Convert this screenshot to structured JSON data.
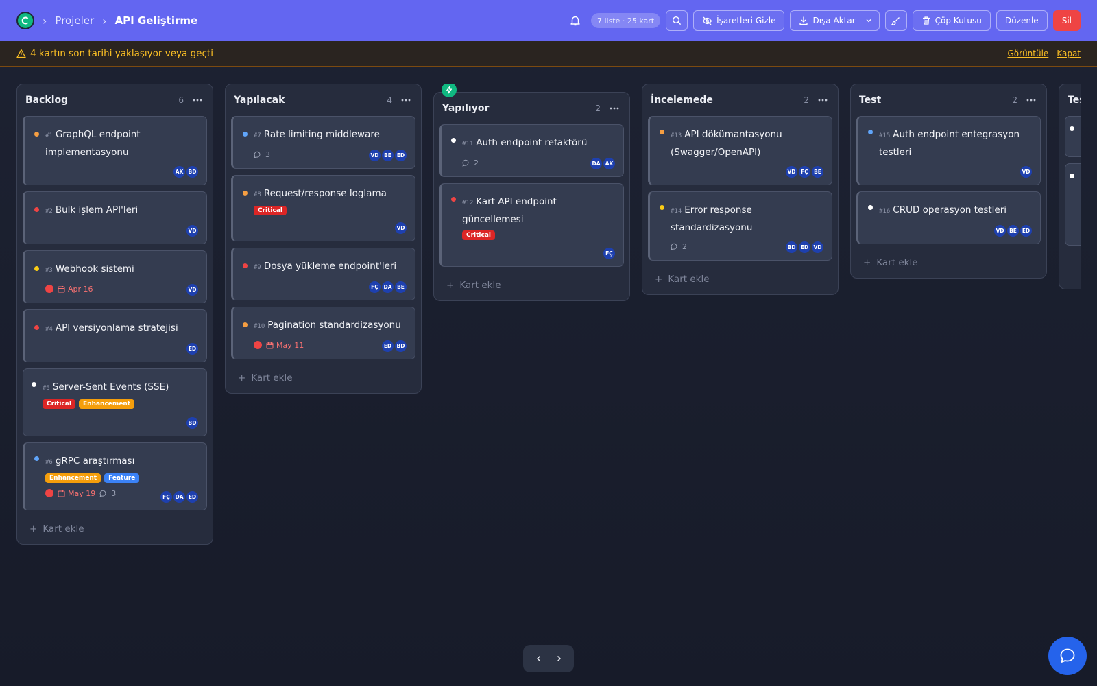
{
  "breadcrumb": {
    "parent": "Projeler",
    "current": "API Geliştirme"
  },
  "toolbar": {
    "stats": "7 liste · 25 kart",
    "hide_marks": "İşaretleri Gizle",
    "export": "Dışa Aktar",
    "trash": "Çöp Kutusu",
    "edit": "Düzenle",
    "delete": "Sil"
  },
  "alert": {
    "message": "4 kartın son tarihi yaklaşıyor veya geçti",
    "view": "Görüntüle",
    "close": "Kapat"
  },
  "add_card_label": "Kart ekle",
  "colors": {
    "topbar": "#6366f1",
    "critical": "#dc2626",
    "enhancement": "#f59e0b",
    "feature": "#3b82f6",
    "avatar": "#1e40af",
    "accent_green": "#10b981"
  },
  "columns": [
    {
      "title": "Backlog",
      "count": "6",
      "cards": [
        {
          "num": "#1",
          "title": "GraphQL endpoint implementasyonu",
          "dot": "#f59e42",
          "tags": [],
          "avatars": [
            "AK",
            "BD"
          ]
        },
        {
          "num": "#2",
          "title": "Bulk işlem API'leri",
          "dot": "#ef4444",
          "tags": [],
          "avatars": [
            "VD"
          ]
        },
        {
          "num": "#3",
          "title": "Webhook sistemi",
          "dot": "#facc15",
          "tags": [],
          "date": "Apr 16",
          "avatars": [
            "VD"
          ]
        },
        {
          "num": "#4",
          "title": "API versiyonlama stratejisi",
          "dot": "#ef4444",
          "tags": [],
          "avatars": [
            "ED"
          ]
        },
        {
          "num": "#5",
          "title": "Server-Sent Events (SSE)",
          "dot": "#ffffff",
          "tags": [
            "Critical",
            "Enhancement"
          ],
          "avatars": [
            "BD"
          ]
        },
        {
          "num": "#6",
          "title": "gRPC araştırması",
          "dot": "#60a5fa",
          "tags": [
            "Enhancement",
            "Feature"
          ],
          "date": "May 19",
          "comments": "3",
          "avatars": [
            "FÇ",
            "DA",
            "ED"
          ]
        }
      ]
    },
    {
      "title": "Yapılacak",
      "count": "4",
      "cards": [
        {
          "num": "#7",
          "title": "Rate limiting middleware",
          "dot": "#60a5fa",
          "tags": [],
          "comments": "3",
          "avatars": [
            "VD",
            "BE",
            "ED"
          ]
        },
        {
          "num": "#8",
          "title": "Request/response loglama",
          "dot": "#f59e42",
          "tags": [
            "Critical"
          ],
          "avatars": [
            "VD"
          ]
        },
        {
          "num": "#9",
          "title": "Dosya yükleme endpoint'leri",
          "dot": "#ef4444",
          "tags": [],
          "avatars": [
            "FÇ",
            "DA",
            "BE"
          ]
        },
        {
          "num": "#10",
          "title": "Pagination standardizasyonu",
          "dot": "#f59e42",
          "tags": [],
          "date": "May 11",
          "avatars": [
            "ED",
            "BD"
          ]
        }
      ]
    },
    {
      "title": "Yapılıyor",
      "count": "2",
      "cards": [
        {
          "num": "#11",
          "title": "Auth endpoint refaktörü",
          "dot": "#ffffff",
          "tags": [],
          "comments": "2",
          "avatars": [
            "DA",
            "AK"
          ]
        },
        {
          "num": "#12",
          "title": "Kart API endpoint güncellemesi",
          "dot": "#ef4444",
          "tags": [
            "Critical"
          ],
          "avatars": [
            "FÇ"
          ]
        }
      ]
    },
    {
      "title": "İncelemede",
      "count": "2",
      "cards": [
        {
          "num": "#13",
          "title": "API dökümantasyonu (Swagger/OpenAPI)",
          "dot": "#f59e42",
          "tags": [],
          "avatars": [
            "VD",
            "FÇ",
            "BE"
          ]
        },
        {
          "num": "#14",
          "title": "Error response standardizasyonu",
          "dot": "#facc15",
          "tags": [],
          "comments": "2",
          "avatars": [
            "BD",
            "ED",
            "VD"
          ]
        }
      ]
    },
    {
      "title": "Test",
      "count": "2",
      "cards": [
        {
          "num": "#15",
          "title": "Auth endpoint entegrasyon testleri",
          "dot": "#60a5fa",
          "tags": [],
          "avatars": [
            "VD"
          ]
        },
        {
          "num": "#16",
          "title": "CRUD operasyon testleri",
          "dot": "#ffffff",
          "tags": [],
          "avatars": [
            "VD",
            "BE",
            "ED"
          ]
        }
      ]
    },
    {
      "title": "Tes",
      "count": "",
      "cards": []
    }
  ]
}
